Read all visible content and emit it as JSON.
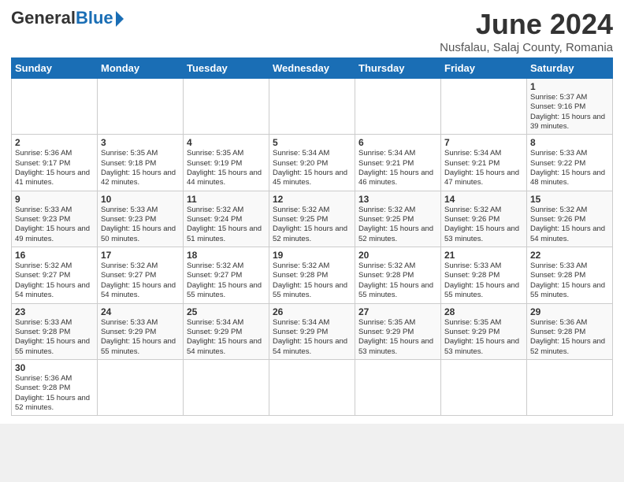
{
  "logo": {
    "general": "General",
    "blue": "Blue"
  },
  "title": "June 2024",
  "subtitle": "Nusfalau, Salaj County, Romania",
  "days_of_week": [
    "Sunday",
    "Monday",
    "Tuesday",
    "Wednesday",
    "Thursday",
    "Friday",
    "Saturday"
  ],
  "weeks": [
    [
      {
        "day": "",
        "info": ""
      },
      {
        "day": "",
        "info": ""
      },
      {
        "day": "",
        "info": ""
      },
      {
        "day": "",
        "info": ""
      },
      {
        "day": "",
        "info": ""
      },
      {
        "day": "",
        "info": ""
      },
      {
        "day": "1",
        "info": "Sunrise: 5:37 AM\nSunset: 9:16 PM\nDaylight: 15 hours and 39 minutes."
      }
    ],
    [
      {
        "day": "2",
        "info": "Sunrise: 5:36 AM\nSunset: 9:17 PM\nDaylight: 15 hours and 41 minutes."
      },
      {
        "day": "3",
        "info": "Sunrise: 5:35 AM\nSunset: 9:18 PM\nDaylight: 15 hours and 42 minutes."
      },
      {
        "day": "4",
        "info": "Sunrise: 5:35 AM\nSunset: 9:19 PM\nDaylight: 15 hours and 44 minutes."
      },
      {
        "day": "5",
        "info": "Sunrise: 5:34 AM\nSunset: 9:20 PM\nDaylight: 15 hours and 45 minutes."
      },
      {
        "day": "6",
        "info": "Sunrise: 5:34 AM\nSunset: 9:21 PM\nDaylight: 15 hours and 46 minutes."
      },
      {
        "day": "7",
        "info": "Sunrise: 5:34 AM\nSunset: 9:21 PM\nDaylight: 15 hours and 47 minutes."
      },
      {
        "day": "8",
        "info": "Sunrise: 5:33 AM\nSunset: 9:22 PM\nDaylight: 15 hours and 48 minutes."
      }
    ],
    [
      {
        "day": "9",
        "info": "Sunrise: 5:33 AM\nSunset: 9:23 PM\nDaylight: 15 hours and 49 minutes."
      },
      {
        "day": "10",
        "info": "Sunrise: 5:33 AM\nSunset: 9:23 PM\nDaylight: 15 hours and 50 minutes."
      },
      {
        "day": "11",
        "info": "Sunrise: 5:32 AM\nSunset: 9:24 PM\nDaylight: 15 hours and 51 minutes."
      },
      {
        "day": "12",
        "info": "Sunrise: 5:32 AM\nSunset: 9:25 PM\nDaylight: 15 hours and 52 minutes."
      },
      {
        "day": "13",
        "info": "Sunrise: 5:32 AM\nSunset: 9:25 PM\nDaylight: 15 hours and 52 minutes."
      },
      {
        "day": "14",
        "info": "Sunrise: 5:32 AM\nSunset: 9:26 PM\nDaylight: 15 hours and 53 minutes."
      },
      {
        "day": "15",
        "info": "Sunrise: 5:32 AM\nSunset: 9:26 PM\nDaylight: 15 hours and 54 minutes."
      }
    ],
    [
      {
        "day": "16",
        "info": "Sunrise: 5:32 AM\nSunset: 9:27 PM\nDaylight: 15 hours and 54 minutes."
      },
      {
        "day": "17",
        "info": "Sunrise: 5:32 AM\nSunset: 9:27 PM\nDaylight: 15 hours and 54 minutes."
      },
      {
        "day": "18",
        "info": "Sunrise: 5:32 AM\nSunset: 9:27 PM\nDaylight: 15 hours and 55 minutes."
      },
      {
        "day": "19",
        "info": "Sunrise: 5:32 AM\nSunset: 9:28 PM\nDaylight: 15 hours and 55 minutes."
      },
      {
        "day": "20",
        "info": "Sunrise: 5:32 AM\nSunset: 9:28 PM\nDaylight: 15 hours and 55 minutes."
      },
      {
        "day": "21",
        "info": "Sunrise: 5:33 AM\nSunset: 9:28 PM\nDaylight: 15 hours and 55 minutes."
      },
      {
        "day": "22",
        "info": "Sunrise: 5:33 AM\nSunset: 9:28 PM\nDaylight: 15 hours and 55 minutes."
      }
    ],
    [
      {
        "day": "23",
        "info": "Sunrise: 5:33 AM\nSunset: 9:28 PM\nDaylight: 15 hours and 55 minutes."
      },
      {
        "day": "24",
        "info": "Sunrise: 5:33 AM\nSunset: 9:29 PM\nDaylight: 15 hours and 55 minutes."
      },
      {
        "day": "25",
        "info": "Sunrise: 5:34 AM\nSunset: 9:29 PM\nDaylight: 15 hours and 54 minutes."
      },
      {
        "day": "26",
        "info": "Sunrise: 5:34 AM\nSunset: 9:29 PM\nDaylight: 15 hours and 54 minutes."
      },
      {
        "day": "27",
        "info": "Sunrise: 5:35 AM\nSunset: 9:29 PM\nDaylight: 15 hours and 53 minutes."
      },
      {
        "day": "28",
        "info": "Sunrise: 5:35 AM\nSunset: 9:29 PM\nDaylight: 15 hours and 53 minutes."
      },
      {
        "day": "29",
        "info": "Sunrise: 5:36 AM\nSunset: 9:28 PM\nDaylight: 15 hours and 52 minutes."
      }
    ],
    [
      {
        "day": "30",
        "info": "Sunrise: 5:36 AM\nSunset: 9:28 PM\nDaylight: 15 hours and 52 minutes."
      },
      {
        "day": "",
        "info": ""
      },
      {
        "day": "",
        "info": ""
      },
      {
        "day": "",
        "info": ""
      },
      {
        "day": "",
        "info": ""
      },
      {
        "day": "",
        "info": ""
      },
      {
        "day": "",
        "info": ""
      }
    ]
  ]
}
